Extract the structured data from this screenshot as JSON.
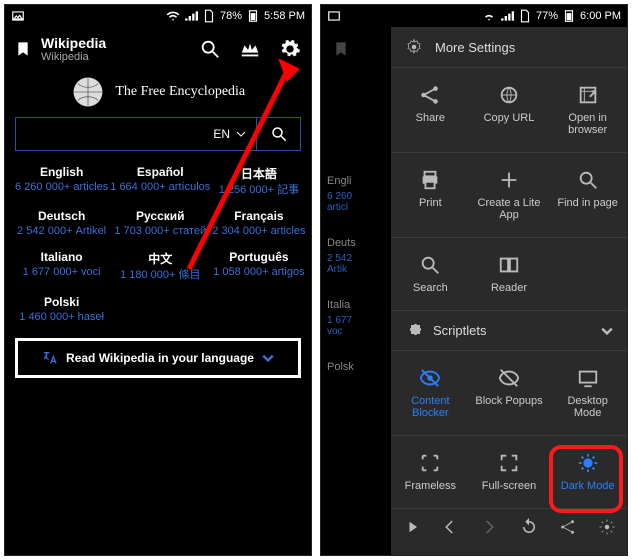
{
  "left": {
    "status": {
      "battery": "78%",
      "time": "5:58 PM"
    },
    "title": "Wikipedia",
    "subtitle": "Wikipedia",
    "tagline": "The Free Encyclopedia",
    "search_lang": "EN",
    "langs": [
      {
        "name": "English",
        "count": "6 260 000+ articles"
      },
      {
        "name": "Español",
        "count": "1 664 000+ artículos"
      },
      {
        "name": "日本語",
        "count": "1 256 000+ 記事"
      },
      {
        "name": "Deutsch",
        "count": "2 542 000+ Artikel"
      },
      {
        "name": "Русский",
        "count": "1 703 000+ статей"
      },
      {
        "name": "Français",
        "count": "2 304 000+ articles"
      },
      {
        "name": "Italiano",
        "count": "1 677 000+ voci"
      },
      {
        "name": "中文",
        "count": "1 180 000+ 條目"
      },
      {
        "name": "Português",
        "count": "1 058 000+ artigos"
      },
      {
        "name": "Polski",
        "count": "1 460 000+ haseł"
      },
      {
        "name": "",
        "count": ""
      },
      {
        "name": "",
        "count": ""
      }
    ],
    "read_label": "Read Wikipedia in your language"
  },
  "right": {
    "status": {
      "battery": "77%",
      "time": "6:00 PM"
    },
    "more": "More Settings",
    "row1": [
      {
        "label": "Share"
      },
      {
        "label": "Copy URL"
      },
      {
        "label": "Open in browser"
      }
    ],
    "row2": [
      {
        "label": "Print"
      },
      {
        "label": "Create a Lite App"
      },
      {
        "label": "Find in page"
      }
    ],
    "row3": [
      {
        "label": "Search"
      },
      {
        "label": "Reader"
      }
    ],
    "scriptlets": "Scriptlets",
    "row4": [
      {
        "label": "Content Blocker",
        "active": true
      },
      {
        "label": "Block Popups"
      },
      {
        "label": "Desktop Mode"
      }
    ],
    "row5": [
      {
        "label": "Frameless"
      },
      {
        "label": "Full-screen"
      },
      {
        "label": "Dark Mode",
        "active": true
      }
    ],
    "peek_langs": [
      {
        "n": "Engli",
        "c": "6 260\narticl"
      },
      {
        "n": "Deuts",
        "c": "2 542\nArtik"
      },
      {
        "n": "Italia",
        "c": "1 677\nvoc"
      },
      {
        "n": "Polsk",
        "c": ""
      }
    ]
  }
}
